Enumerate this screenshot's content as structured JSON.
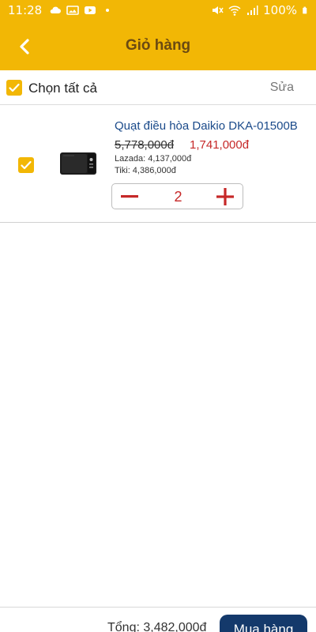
{
  "status_bar": {
    "time": "11:28",
    "battery": "100%"
  },
  "header": {
    "title": "Giỏ hàng",
    "back_icon": "chevron-left-icon"
  },
  "select_all": {
    "label": "Chọn tất cả",
    "checked": true,
    "edit_label": "Sửa"
  },
  "cart": {
    "items": [
      {
        "name": "Quạt điều hòa Daikio DKA-01500B",
        "old_price": "5,778,000đ",
        "price": "1,741,000đ",
        "lazada": "Lazada: 4,137,000đ",
        "tiki": "Tiki: 4,386,000đ",
        "quantity": "2",
        "checked": true
      }
    ]
  },
  "footer": {
    "total": "Tổng: 3,482,000đ",
    "buy_label": "Mua hàng"
  },
  "colors": {
    "accent": "#f2b705",
    "title_text": "#6b4a12",
    "price": "#c62828",
    "product_name": "#1a4a8a",
    "buy_button": "#14396b"
  }
}
